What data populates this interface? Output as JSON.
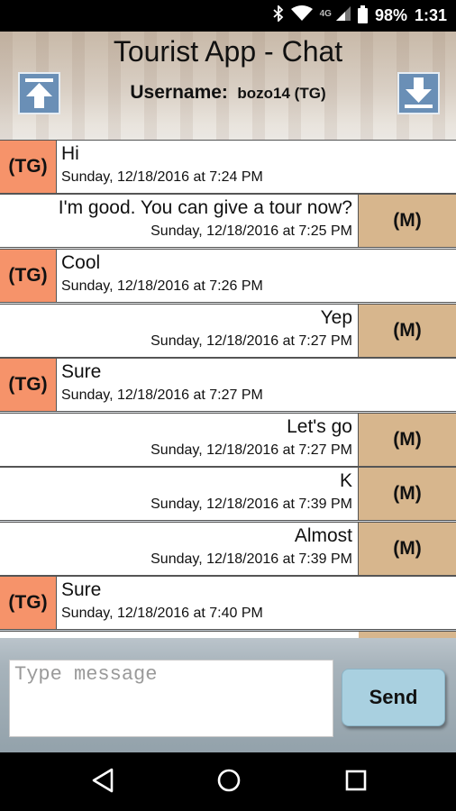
{
  "status_bar": {
    "icons": [
      "bluetooth-icon",
      "wifi-icon",
      "lte-signal-icon",
      "battery-icon"
    ],
    "network": "4G",
    "battery": "98%",
    "time": "1:31"
  },
  "header": {
    "title": "Tourist App - Chat",
    "username_label": "Username:",
    "username_value": "bozo14 (TG)"
  },
  "colors": {
    "tourist_tag": "#f6936a",
    "guide_tag": "#d7b68d",
    "send_button": "#a9d0e0",
    "scroll_button": "#6a8fb6"
  },
  "messages": [
    {
      "sender": "(TG)",
      "text": "Hi",
      "timestamp": "Sunday, 12/18/2016 at 7:24 PM"
    },
    {
      "sender": "(M)",
      "text": "I'm good. You can give a tour now?",
      "timestamp": "Sunday, 12/18/2016 at 7:25 PM"
    },
    {
      "sender": "(TG)",
      "text": "Cool",
      "timestamp": "Sunday, 12/18/2016 at 7:26 PM"
    },
    {
      "sender": "(M)",
      "text": "Yep",
      "timestamp": "Sunday, 12/18/2016 at 7:27 PM"
    },
    {
      "sender": "(TG)",
      "text": "Sure",
      "timestamp": "Sunday, 12/18/2016 at 7:27 PM"
    },
    {
      "sender": "(M)",
      "text": "Let's go",
      "timestamp": "Sunday, 12/18/2016 at 7:27 PM"
    },
    {
      "sender": "(M)",
      "text": "K",
      "timestamp": "Sunday, 12/18/2016 at 7:39 PM"
    },
    {
      "sender": "(M)",
      "text": "Almost",
      "timestamp": "Sunday, 12/18/2016 at 7:39 PM"
    },
    {
      "sender": "(TG)",
      "text": "Sure",
      "timestamp": "Sunday, 12/18/2016 at 7:40 PM"
    }
  ],
  "composer": {
    "placeholder": "Type message",
    "value": "",
    "send_label": "Send"
  },
  "nav_bar": {
    "buttons": [
      "back-icon",
      "home-icon",
      "recents-icon"
    ]
  }
}
